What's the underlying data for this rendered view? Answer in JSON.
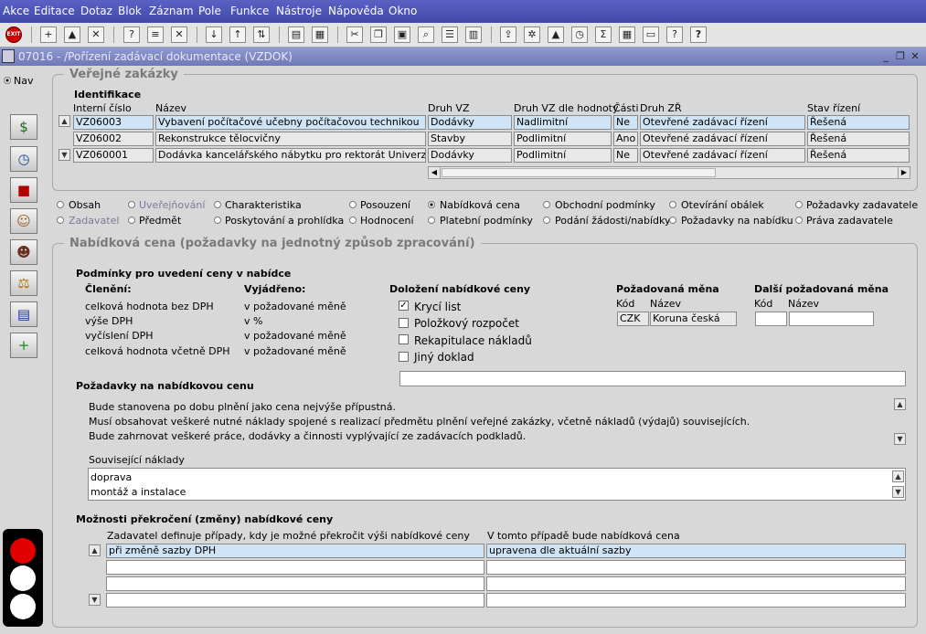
{
  "menu": [
    "Akce",
    "Editace",
    "Dotaz",
    "Blok",
    "Záznam",
    "Pole",
    "Funkce",
    "Nástroje",
    "Nápověda",
    "Okno"
  ],
  "toolbar": {
    "exit_label": "EXIT",
    "help_label": "?"
  },
  "window": {
    "title": "07016 - /Pořízení zadávací dokumentace (VZDOK)"
  },
  "nav": {
    "label": "Nav"
  },
  "vz": {
    "legend": "Veřejné zakázky",
    "ident_label": "Identifikace",
    "columns": [
      "Interní číslo",
      "Název",
      "Druh VZ",
      "Druh VZ dle hodnoty",
      "Části",
      "Druh ZŘ",
      "Stav řízení"
    ],
    "rows": [
      {
        "id": "VZ06003",
        "name": "Vybavení počítačové učebny počítačovou technikou",
        "druh": "Dodávky",
        "hodnota": "Nadlimitní",
        "casti": "Ne",
        "zr": "Otevřené zadávací řízení",
        "stav": "Řešená"
      },
      {
        "id": "VZ06002",
        "name": "Rekonstrukce tělocvičny",
        "druh": "Stavby",
        "hodnota": "Podlimitní",
        "casti": "Ano",
        "zr": "Otevřené zadávací řízení",
        "stav": "Řešená"
      },
      {
        "id": "VZ060001",
        "name": "Dodávka kancelářského nábytku pro rektorát Univerzity",
        "druh": "Dodávky",
        "hodnota": "Podlimitní",
        "casti": "Ne",
        "zr": "Otevřené zadávací řízení",
        "stav": "Řešená"
      }
    ]
  },
  "tabs": [
    {
      "label": "Obsah",
      "on": false,
      "dis": false
    },
    {
      "label": "Uveřejňování",
      "on": false,
      "dis": true
    },
    {
      "label": "Charakteristika",
      "on": false,
      "dis": false
    },
    {
      "label": "Posouzení",
      "on": false,
      "dis": false
    },
    {
      "label": "Nabídková cena",
      "on": true,
      "dis": false
    },
    {
      "label": "Obchodní podmínky",
      "on": false,
      "dis": false
    },
    {
      "label": "Otevírání obálek",
      "on": false,
      "dis": false
    },
    {
      "label": "Požadavky zadavatele",
      "on": false,
      "dis": false
    },
    {
      "label": "Zadavatel",
      "on": false,
      "dis": true
    },
    {
      "label": "Předmět",
      "on": false,
      "dis": false
    },
    {
      "label": "Poskytování a prohlídka",
      "on": false,
      "dis": false
    },
    {
      "label": "Hodnocení",
      "on": false,
      "dis": false
    },
    {
      "label": "Platební podmínky",
      "on": false,
      "dis": false
    },
    {
      "label": "Podání žádosti/nabídky",
      "on": false,
      "dis": false
    },
    {
      "label": "Požadavky na nabídku",
      "on": false,
      "dis": false
    },
    {
      "label": "Práva zadavatele",
      "on": false,
      "dis": false
    }
  ],
  "nc": {
    "legend": "Nabídková cena (požadavky na jednotný způsob zpracování)",
    "podminky_title": "Podmínky pro uvedení ceny v nabídce",
    "cleneni_label": "Členění:",
    "vyjadreno_label": "Vyjádřeno:",
    "rows": [
      {
        "c": "celková hodnota bez DPH",
        "v": "v požadované měně"
      },
      {
        "c": "výše DPH",
        "v": "v %"
      },
      {
        "c": "vyčíslení DPH",
        "v": "v požadované měně"
      },
      {
        "c": "celková hodnota včetně DPH",
        "v": "v požadované měně"
      }
    ],
    "dolozeni_title": "Doložení nabídkové ceny",
    "checks": [
      {
        "label": "Krycí list",
        "checked": true
      },
      {
        "label": "Položkový rozpočet",
        "checked": false
      },
      {
        "label": "Rekapitulace nákladů",
        "checked": false
      },
      {
        "label": "Jiný doklad",
        "checked": false
      }
    ],
    "check_mark": "✓",
    "mena_title": "Požadovaná měna",
    "kod_label": "Kód",
    "nazev_label": "Název",
    "mena_kod": "CZK",
    "mena_nazev": "Koruna česká",
    "dalsi_title": "Další požadovaná měna",
    "dalsi_kod_label": "Kód",
    "dalsi_nazev_label": "Název",
    "pozadavky_title": "Požadavky na nabídkovou cenu",
    "pozadavky_lines": [
      "Bude stanovena po dobu plnění jako cena nejvýše přípustná.",
      "Musí obsahovat veškeré nutné náklady spojené s realizací předmětu plnění veřejné zakázky, včetně nákladů (výdajů) souvisejících.",
      "Bude zahrnovat veškeré práce, dodávky a činnosti vyplývající ze zadávacích podkladů."
    ],
    "souvisejici_label": "Související náklady",
    "souvisejici_lines": [
      "doprava",
      "montáž a instalace"
    ],
    "moznosti_title": "Možnosti překročení (změny) nabídkové ceny",
    "moz_col1": "Zadavatel definuje případy, kdy je možné překročit výši nabídkové ceny",
    "moz_col2": "V tomto případě bude nabídková cena",
    "moz_rows": [
      {
        "a": "při změně sazby DPH",
        "b": "upravena dle aktuální sazby"
      },
      {
        "a": "",
        "b": ""
      },
      {
        "a": "",
        "b": ""
      },
      {
        "a": "",
        "b": ""
      }
    ]
  }
}
